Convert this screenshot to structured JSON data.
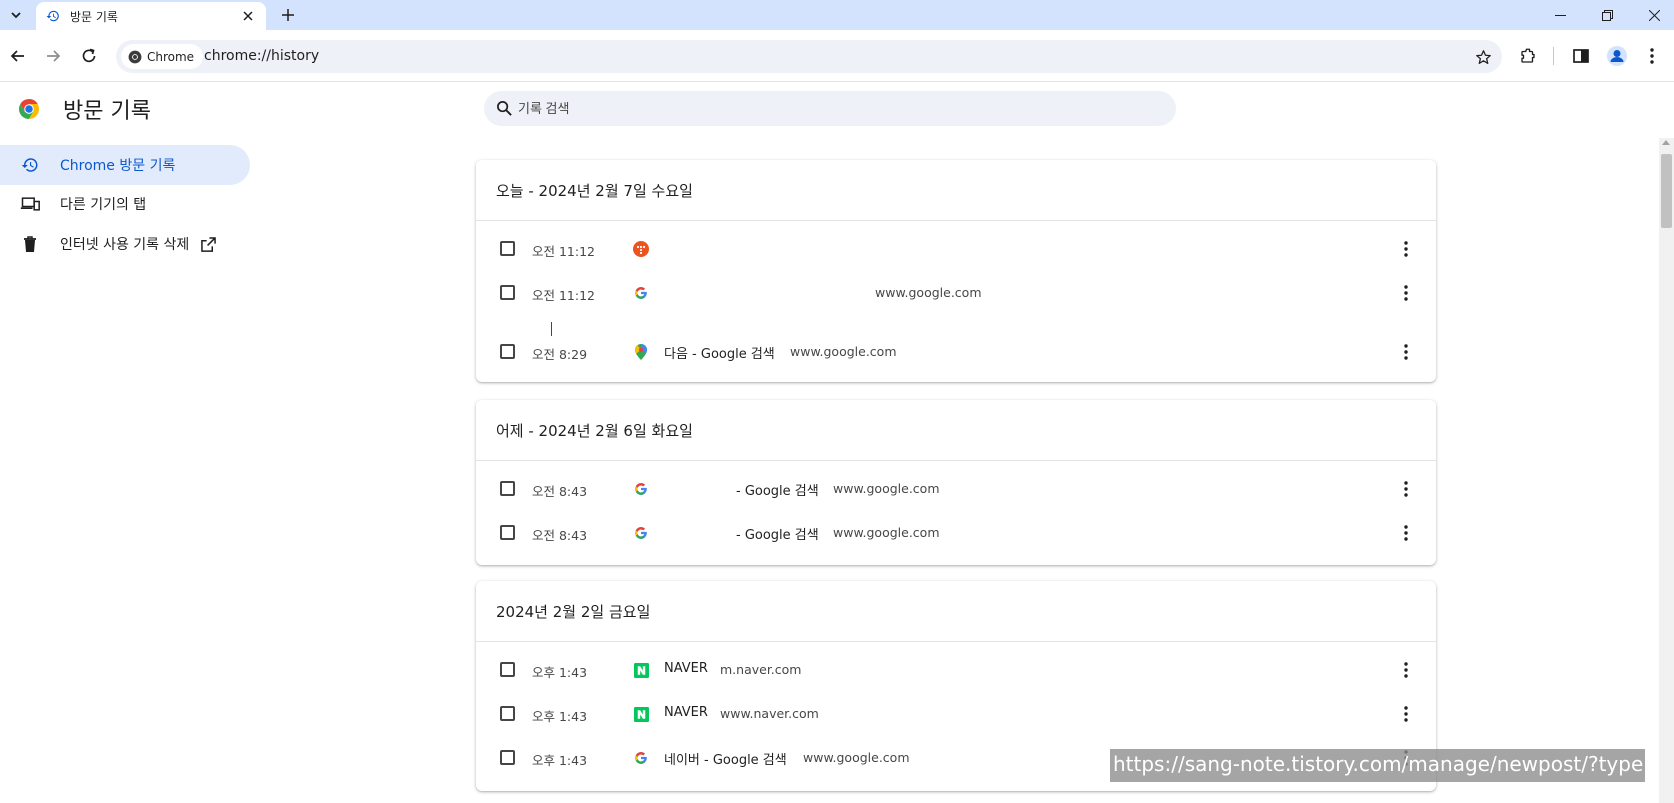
{
  "colors": {
    "tabstrip_bg": "#d3e3fd",
    "omnibox_bg": "#eef1f8",
    "active_nav_bg": "#e2ebfb",
    "accent": "#0b57d0",
    "naver_green": "#03c75a",
    "watermark_bg": "#8c8c8c"
  },
  "tab": {
    "title": "방문 기록",
    "favicon": "history-icon"
  },
  "toolbar": {
    "chip_label": "Chrome",
    "url": "chrome://history"
  },
  "page": {
    "title": "방문 기록",
    "search_placeholder": "기록 검색"
  },
  "sidebar": {
    "items": [
      {
        "label": "Chrome 방문 기록",
        "icon": "history-icon",
        "active": true
      },
      {
        "label": "다른 기기의 탭",
        "icon": "devices-icon",
        "active": false
      },
      {
        "label": "인터넷 사용 기록 삭제",
        "icon": "trash-icon",
        "active": false,
        "trailing_icon": "open-in-new-icon"
      }
    ]
  },
  "groups": [
    {
      "title": "오늘 - 2024년 2월 7일 수요일",
      "entries": [
        {
          "time": "오전 11:12",
          "favicon": "tistory-favicon",
          "title": "",
          "domain": ""
        },
        {
          "time": "오전 11:12",
          "favicon": "google-favicon",
          "title": "",
          "domain": "www.google.com"
        },
        {
          "time": "오전 8:29",
          "favicon": "maps-favicon",
          "title": "다음 - Google 검색",
          "domain": "www.google.com"
        }
      ]
    },
    {
      "title": "어제 - 2024년 2월 6일 화요일",
      "entries": [
        {
          "time": "오전 8:43",
          "favicon": "google-favicon",
          "title": "- Google 검색",
          "domain": "www.google.com"
        },
        {
          "time": "오전 8:43",
          "favicon": "google-favicon",
          "title": "- Google 검색",
          "domain": "www.google.com"
        }
      ]
    },
    {
      "title": "2024년 2월 2일 금요일",
      "entries": [
        {
          "time": "오후 1:43",
          "favicon": "naver-favicon",
          "title": "NAVER",
          "domain": "m.naver.com"
        },
        {
          "time": "오후 1:43",
          "favicon": "naver-favicon",
          "title": "NAVER",
          "domain": "www.naver.com"
        },
        {
          "time": "오후 1:43",
          "favicon": "google-favicon",
          "title": "네이버 - Google 검색",
          "domain": "www.google.com"
        }
      ]
    }
  ],
  "watermark": "https://sang-note.tistory.com/manage/newpost/?type"
}
